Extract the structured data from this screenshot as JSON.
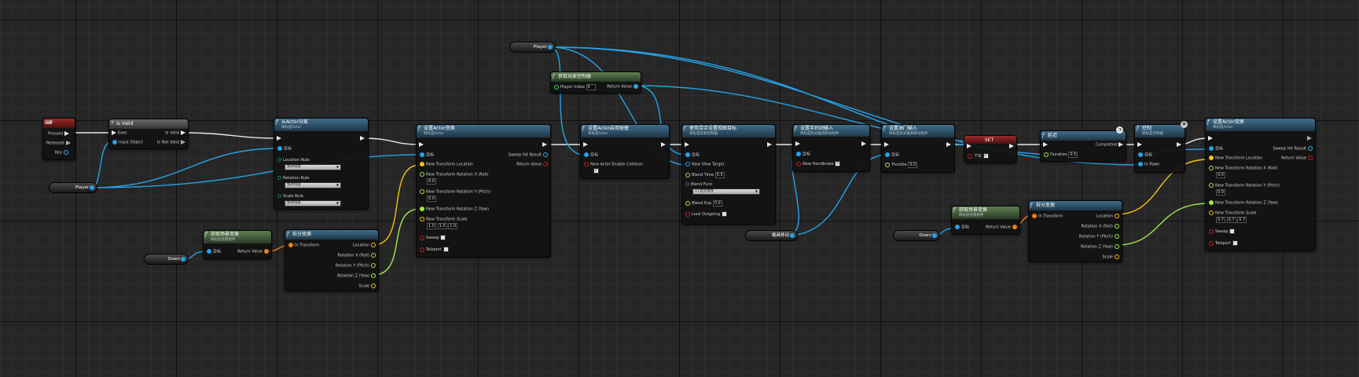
{
  "nodes": {
    "key_f": {
      "title": "F",
      "pressed": "Pressed",
      "released": "Released",
      "key": "Key"
    },
    "is_valid": {
      "title": "Is Valid",
      "exec": "Exec",
      "input_object": "Input Object",
      "is_valid": "Is Valid",
      "is_not_valid": "Is Not Valid"
    },
    "player_var_1": {
      "label": "Player"
    },
    "player_var_2": {
      "label": "Player"
    },
    "detach": {
      "title": "从Actor分离",
      "subtitle": "目标是Actor",
      "target": "目标",
      "location_rule": "Location Rule",
      "location_rule_val": "保持场景",
      "rotation_rule": "Rotation Rule",
      "rotation_rule_val": "保持场景",
      "scale_rule": "Scale Rule",
      "scale_rule_val": "保持场景"
    },
    "down_var_1": {
      "label": "Down"
    },
    "get_world_transform_1": {
      "title": "获取场景变换",
      "subtitle": "目标是场景组件",
      "target": "目标",
      "return_value": "Return Value"
    },
    "break_transform_1": {
      "title": "拆分变换",
      "in_transform": "In Transform",
      "location": "Location",
      "rot_x": "Rotation X (Roll)",
      "rot_y": "Rotation Y (Pitch)",
      "rot_z": "Rotation Z (Yaw)",
      "scale": "Scale"
    },
    "set_transform_1": {
      "title": "设置Actor变换",
      "subtitle": "目标是Actor",
      "target": "目标",
      "new_loc": "New Transform Location",
      "new_rot_x": "New Transform Rotation X (Roll)",
      "new_rot_x_val": "0.0",
      "new_rot_y": "New Transform Rotation Y (Pitch)",
      "new_rot_y_val": "0.0",
      "new_rot_z": "New Transform Rotation Z (Yaw)",
      "new_scale": "New Transform Scale",
      "scale_x": "1.0",
      "scale_y": "1.0",
      "scale_z": "1.0",
      "sweep": "Sweep",
      "teleport": "Teleport",
      "sweep_hit": "Sweep Hit Result",
      "return_value": "Return Value"
    },
    "get_controller": {
      "title": "获取玩家控制器",
      "player_index": "Player Index",
      "player_index_val": "0",
      "return_value": "Return Value"
    },
    "set_collision": {
      "title": "设置Actor启用碰撞",
      "subtitle": "目标是Actor",
      "target": "目标",
      "enable_collision": "New Actor Enable Collision"
    },
    "set_view_target": {
      "title": "使用混合设置视图目标",
      "subtitle": "目标是玩家控制器",
      "target": "目标",
      "new_view_target": "New View Target",
      "blend_time": "Blend Time",
      "blend_time_val": "0.5",
      "blend_func": "Blend Func",
      "blend_func_val": "VT混合线性",
      "blend_exp": "Blend Exp",
      "blend_exp_val": "0.0",
      "lock_outgoing": "Lock Outgoing"
    },
    "vehicle_var": {
      "label": "载具移动"
    },
    "handbrake": {
      "title": "设置手刹动输入",
      "subtitle": "目标是轮式载具移动组件",
      "target": "目标",
      "new_handbrake": "New Handbrake"
    },
    "throttle": {
      "title": "设置油门输入",
      "subtitle": "目标是轮式载具移动组件",
      "target": "目标",
      "throttle": "Throttle",
      "throttle_val": "0.0"
    },
    "set_var": {
      "title": "SET",
      "label": "下车"
    },
    "delay": {
      "title": "延迟",
      "duration": "Duration",
      "duration_val": "0.5",
      "completed": "Completed"
    },
    "possess": {
      "title": "控制",
      "subtitle": "目标是控制器",
      "target": "目标",
      "in_pawn": "In Pawn"
    },
    "down_var_2": {
      "label": "Down"
    },
    "get_world_transform_2": {
      "title": "获取场景变换",
      "subtitle": "目标是场景组件",
      "target": "目标",
      "return_value": "Return Value"
    },
    "break_transform_2": {
      "title": "拆分变换",
      "in_transform": "In Transform",
      "location": "Location",
      "rot_x": "Rotation X (Roll)",
      "rot_y": "Rotation Y (Pitch)",
      "rot_z": "Rotation Z (Yaw)",
      "scale": "Scale"
    },
    "set_transform_2": {
      "title": "设置Actor变换",
      "subtitle": "目标是Actor",
      "target": "目标",
      "new_loc": "New Transform Location",
      "new_rot_x": "New Transform Rotation X (Roll)",
      "new_rot_x_val": "0.0",
      "new_rot_y": "New Transform Rotation Y (Pitch)",
      "new_rot_y_val": "0.0",
      "new_rot_z": "New Transform Rotation Z (Yaw)",
      "new_scale": "New Transform Scale",
      "scale_x": "0.7",
      "scale_y": "0.7",
      "scale_z": "0.7",
      "sweep": "Sweep",
      "teleport": "Teleport",
      "sweep_hit": "Sweep Hit Result",
      "return_value": "Return Value"
    },
    "player_var_3": {
      "label": "Player"
    }
  },
  "colors": {
    "exec": "#e8e8e8",
    "object": "#25a3e8",
    "transform": "#f07c1a",
    "vector": "#f5c318",
    "float": "#a2e84a",
    "boolean": "#c02222"
  }
}
